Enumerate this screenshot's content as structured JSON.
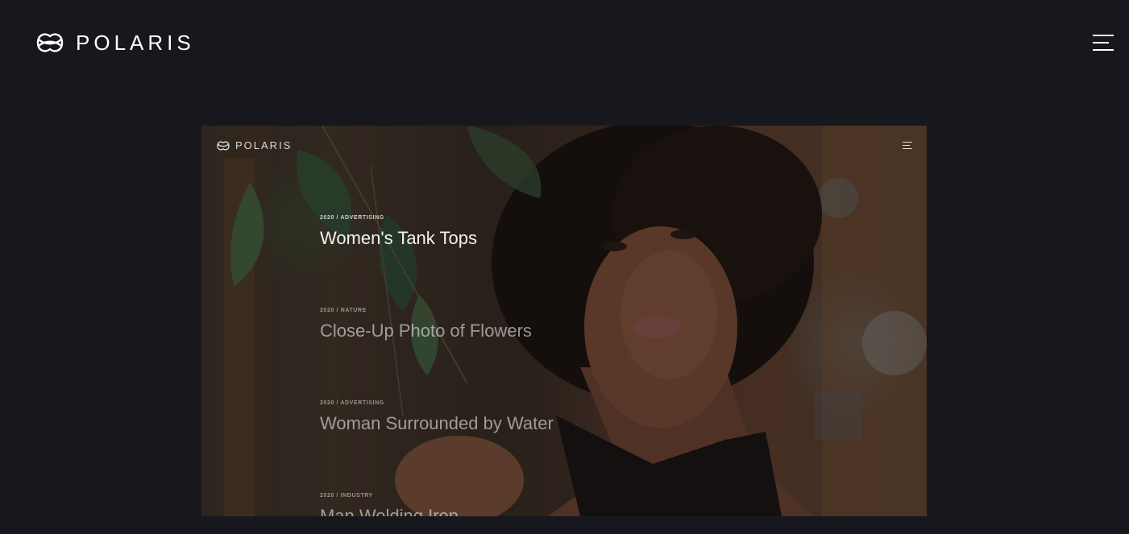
{
  "header": {
    "brand": "POLARIS",
    "logo_icon": "polaris-logo-icon",
    "menu_icon": "hamburger-menu-icon"
  },
  "preview": {
    "image_description_icon": "portfolio-preview-image",
    "brand": "POLARIS",
    "projects": [
      {
        "meta": "2020 / ADVERTISING",
        "title": "Women's Tank Tops"
      },
      {
        "meta": "2020 / NATURE",
        "title": "Close-Up Photo of Flowers"
      },
      {
        "meta": "2020 / ADVERTISING",
        "title": "Woman Surrounded by Water"
      },
      {
        "meta": "2020 / INDUSTRY",
        "title": "Man Welding Iron"
      }
    ]
  },
  "colors": {
    "background": "#17181d",
    "text": "#ffffff"
  }
}
